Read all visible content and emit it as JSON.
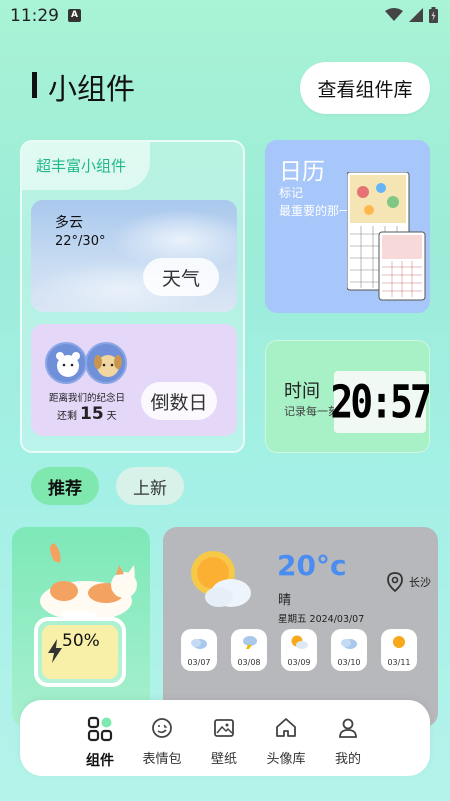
{
  "status": {
    "time": "11:29"
  },
  "header": {
    "title": "小组件",
    "view_library": "查看组件库"
  },
  "featured": {
    "tag": "超丰富小组件",
    "weather": {
      "condition": "多云",
      "temp_range": "22°/30°",
      "button": "天气"
    },
    "countdown": {
      "line1": "距离我们的纪念日",
      "prefix": "还剩",
      "days": "15",
      "suffix": "天",
      "button": "倒数日"
    }
  },
  "calendar": {
    "title": "日历",
    "line1": "标记",
    "line2": "最重要的那一天"
  },
  "time_widget": {
    "title": "时间",
    "subtitle": "记录每一刻",
    "clock": "20:57"
  },
  "tabs": {
    "recommend": "推荐",
    "new": "上新"
  },
  "battery": {
    "percent": "50%",
    "level": 0.5
  },
  "weather_widget": {
    "temp": "20°c",
    "condition": "晴",
    "date": "星期五 2024/03/07",
    "location": "长沙",
    "forecast": [
      {
        "date": "03/07",
        "icon": "cloud-icon"
      },
      {
        "date": "03/08",
        "icon": "thunder-icon"
      },
      {
        "date": "03/09",
        "icon": "sun-cloud-icon"
      },
      {
        "date": "03/10",
        "icon": "cloud-icon"
      },
      {
        "date": "03/11",
        "icon": "sun-icon"
      }
    ]
  },
  "nav": {
    "items": [
      {
        "label": "组件",
        "icon": "widgets-icon"
      },
      {
        "label": "表情包",
        "icon": "emoji-icon"
      },
      {
        "label": "壁纸",
        "icon": "wallpaper-icon"
      },
      {
        "label": "头像库",
        "icon": "home-icon"
      },
      {
        "label": "我的",
        "icon": "profile-icon"
      }
    ]
  },
  "colors": {
    "accent_green": "#7ee8ae",
    "tag_green": "#20b88a",
    "temp_blue": "#4a8cf2",
    "calendar_blue": "#a7c6f9",
    "countdown_purple": "#e4d7f8"
  }
}
